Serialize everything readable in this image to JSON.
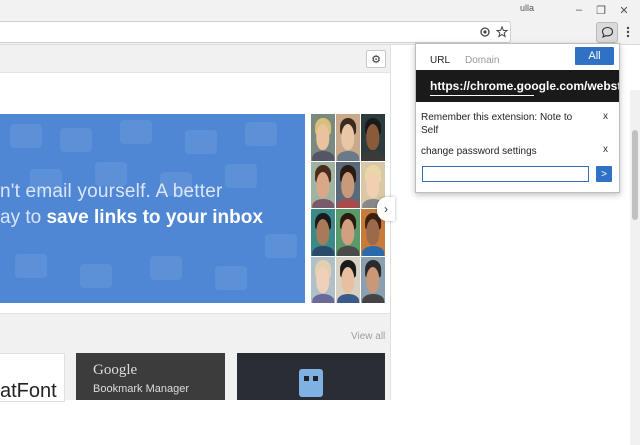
{
  "browser": {
    "profile_name": "ulla",
    "window_buttons": {
      "minimize": "–",
      "restore": "❐",
      "close": "✕"
    },
    "omnibox_value": "",
    "icons": {
      "location": "location-target-icon",
      "bookmark": "star-icon",
      "extension": "speech-bubble-icon",
      "menu": "kebab-menu-icon"
    }
  },
  "store_page": {
    "settings_icon": "gear-icon",
    "hero": {
      "line1": "n't email yourself. A better",
      "line2_prefix": "ay to ",
      "line2_bold": "save links to your inbox",
      "background_color": "#4f87d4"
    },
    "carousel_next": "›",
    "view_all": "View all",
    "tiles": [
      {
        "title_fragment": "atFont"
      },
      {
        "brand": "Google",
        "subtitle": "Bookmark Manager"
      },
      {
        "icon": "robot-icon"
      }
    ]
  },
  "popup": {
    "tabs": [
      "URL",
      "Domain"
    ],
    "all_button": "All",
    "current_url": "https://chrome.google.com/webstore",
    "notes": [
      {
        "text": "Remember this extension: Note to Self",
        "delete": "x"
      },
      {
        "text": "change password settings",
        "delete": "x"
      }
    ],
    "new_note_value": "",
    "add_button": ">",
    "accent_color": "#2f72c4"
  }
}
